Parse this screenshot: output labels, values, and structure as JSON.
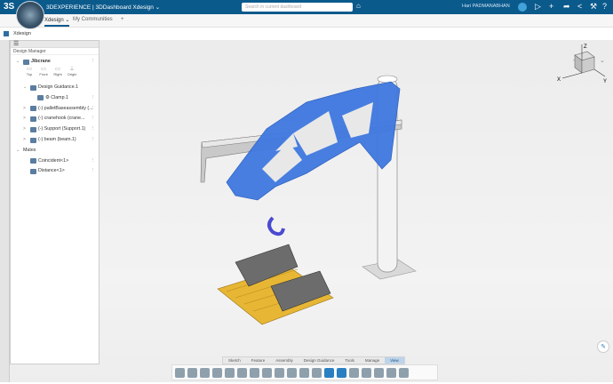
{
  "topbar": {
    "logo": "3S",
    "brand": "3DEXPERIENCE | 3DDashboard Xdesign ⌄",
    "search_placeholder": "Search in current dashboard",
    "user": "Hari PADMANABHAN",
    "icons": [
      "tag-icon",
      "add-icon",
      "share-icon",
      "network-icon",
      "tools-icon",
      "help-icon"
    ]
  },
  "tabs": [
    {
      "label": "Xdesign ⌄",
      "active": true
    },
    {
      "label": "My Communities"
    },
    {
      "label": "+"
    }
  ],
  "subheader": {
    "title": "Xdesign"
  },
  "panel": {
    "title": "Design Manager",
    "root": "Jibcrane",
    "planes": [
      "Top",
      "Front",
      "Right",
      "Origin"
    ],
    "items": [
      {
        "label": "Design Guidance.1",
        "indent": 1,
        "chev": "⌄"
      },
      {
        "label": "⚙ Clamp.1",
        "indent": 2,
        "chev": ""
      },
      {
        "label": "(-) palletBaseassembly (...",
        "indent": 1,
        "chev": ">"
      },
      {
        "label": "(-) cranehook (crane...",
        "indent": 1,
        "chev": ">"
      },
      {
        "label": "(-) Support (Support.1)",
        "indent": 1,
        "chev": ">"
      },
      {
        "label": "(-) beam (beam.1)",
        "indent": 1,
        "chev": ">"
      },
      {
        "label": "Mates",
        "indent": 0,
        "chev": "⌄"
      },
      {
        "label": "Coincident<1>",
        "indent": 1,
        "chev": ""
      },
      {
        "label": "Distance<1>",
        "indent": 1,
        "chev": ""
      }
    ]
  },
  "bottom_tabs": [
    "Sketch",
    "Feature",
    "Assembly",
    "Design Guidance",
    "Tools",
    "Manage",
    "View"
  ],
  "active_bottom_tab": "View",
  "compass_labels": {
    "x": "X",
    "y": "Y",
    "z": "Z"
  }
}
